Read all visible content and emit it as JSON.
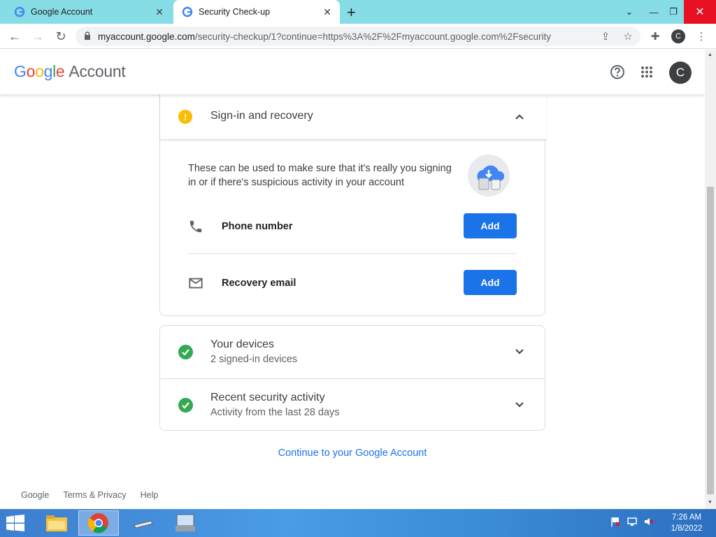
{
  "browser": {
    "tabs": [
      {
        "title": "Google Account"
      },
      {
        "title": "Security Check-up"
      }
    ],
    "url": {
      "host": "myaccount.google.com",
      "path": "/security-checkup/1?continue=https%3A%2F%2Fmyaccount.google.com%2Fsecurity"
    },
    "profile_initial": "C"
  },
  "header": {
    "logo_letters": [
      "G",
      "o",
      "o",
      "g",
      "l",
      "e"
    ],
    "logo_suffix": "Account",
    "avatar_initial": "C"
  },
  "signin_section": {
    "title": "Sign-in and recovery",
    "status": "warning",
    "description": "These can be used to make sure that it's really you signing in or if there's suspicious activity in your account",
    "rows": [
      {
        "label": "Phone number",
        "icon": "phone-icon",
        "button": "Add"
      },
      {
        "label": "Recovery email",
        "icon": "mail-icon",
        "button": "Add"
      }
    ]
  },
  "devices_section": {
    "title": "Your devices",
    "subtitle": "2 signed-in devices",
    "status": "ok"
  },
  "activity_section": {
    "title": "Recent security activity",
    "subtitle": "Activity from the last 28 days",
    "status": "ok"
  },
  "continue_link": "Continue to your Google Account",
  "footer": {
    "links": [
      "Google",
      "Terms & Privacy",
      "Help"
    ]
  },
  "taskbar": {
    "time": "7:26 AM",
    "date": "1/8/2022"
  },
  "colors": {
    "accent": "#1a73e8",
    "warning": "#fbbc04",
    "success": "#34a853",
    "tabstrip": "#87dde6"
  }
}
